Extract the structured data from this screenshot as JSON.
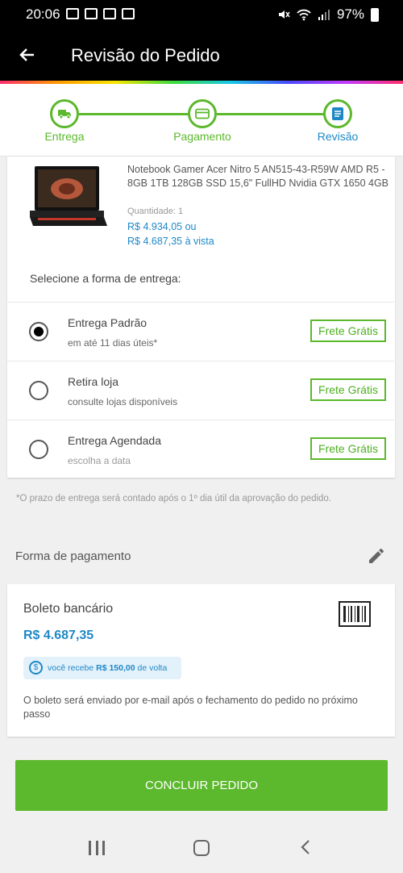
{
  "status_bar": {
    "time": "20:06",
    "battery": "97%"
  },
  "header": {
    "title": "Revisão do Pedido"
  },
  "stepper": {
    "steps": [
      {
        "label": "Entrega",
        "icon": "truck-icon"
      },
      {
        "label": "Pagamento",
        "icon": "card-icon"
      },
      {
        "label": "Revisão",
        "icon": "document-icon"
      }
    ]
  },
  "product": {
    "name": "Notebook Gamer Acer Nitro 5 AN515-43-R59W AMD R5 - 8GB 1TB 128GB SSD 15,6\" FullHD Nvidia GTX 1650 4GB",
    "quantity": "Quantidade:  1",
    "price_installments": "R$ 4.934,05 ou",
    "price_cash": "R$ 4.687,35 à vista"
  },
  "delivery": {
    "label": "Selecione a forma de entrega:",
    "options": [
      {
        "title": "Entrega Padrão",
        "subtitle": "em até 11 dias úteis*",
        "badge": "Frete Grátis",
        "selected": true
      },
      {
        "title": "Retira loja",
        "subtitle": "consulte lojas disponíveis",
        "badge": "Frete Grátis",
        "selected": false
      },
      {
        "title": "Entrega Agendada",
        "subtitle": "escolha a data",
        "badge": "Frete Grátis",
        "selected": false
      }
    ],
    "note": "*O prazo de entrega será contado após o 1º dia útil da aprovação do pedido."
  },
  "payment": {
    "section_title": "Forma de pagamento",
    "method": "Boleto bancário",
    "amount": "R$ 4.687,35",
    "cashback_prefix": "você recebe",
    "cashback_amount": "R$ 150,00",
    "cashback_suffix": "de volta",
    "description": "O boleto será enviado por e-mail após o fechamento do pedido no próximo passo"
  },
  "action": {
    "button_label": "CONCLUIR PEDIDO"
  },
  "colors": {
    "green": "#5cb82c",
    "blue": "#1e88c7",
    "header": "#000000"
  }
}
